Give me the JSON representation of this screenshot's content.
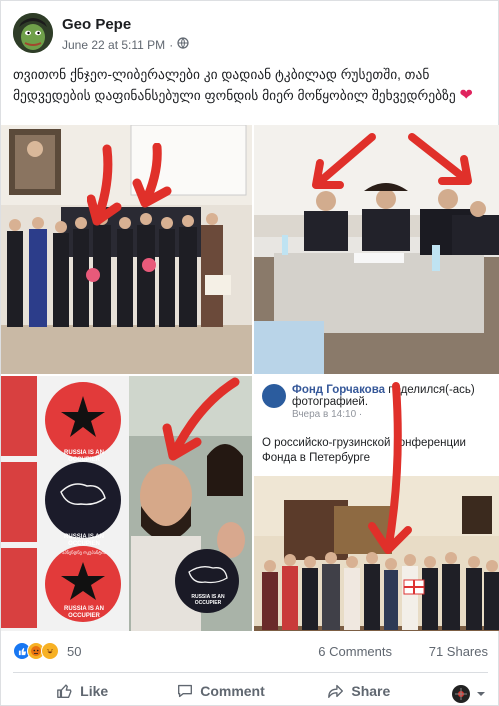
{
  "post": {
    "author": "Geo Pepe",
    "date": "June 22 at 5:11 PM",
    "separator": "·",
    "text": "თვითონ ქნჯეო-ლიბერალები კი დადიან ტკბილად რუსეთში, თან მედვედების დაფინანსებული ფონდის მიერ მოწყობილ შეხვედრებზე",
    "heart": "❤"
  },
  "photos": {
    "occupier_badge": "RUSSIA IS AN OCCUPIER",
    "occupier_badge_small": "RUSSIA IS AN OCCUPIER",
    "occupien_badge": "RUSSIA IS AN OCCUPIEN",
    "occupien_sub": "აპნენდნე ოკუპანტია",
    "selfie_badge": "RUSSIA IS AN OCCUPIER",
    "embedded": {
      "page_name": "Фонд Горчакова",
      "action": " поделился(-ась) фотографией.",
      "time": "Вчера в 14:10 · ",
      "text": "О российско-грузинской конференции Фонда в Петербурге"
    }
  },
  "stats": {
    "reactions": "50",
    "comments": "6 Comments",
    "shares": "71 Shares"
  },
  "actions": {
    "like": "Like",
    "comment": "Comment",
    "share": "Share"
  },
  "colors": {
    "link": "#365899",
    "arrow": "#e0302a",
    "heart": "#e0245e",
    "like_blue": "#1877f2"
  }
}
